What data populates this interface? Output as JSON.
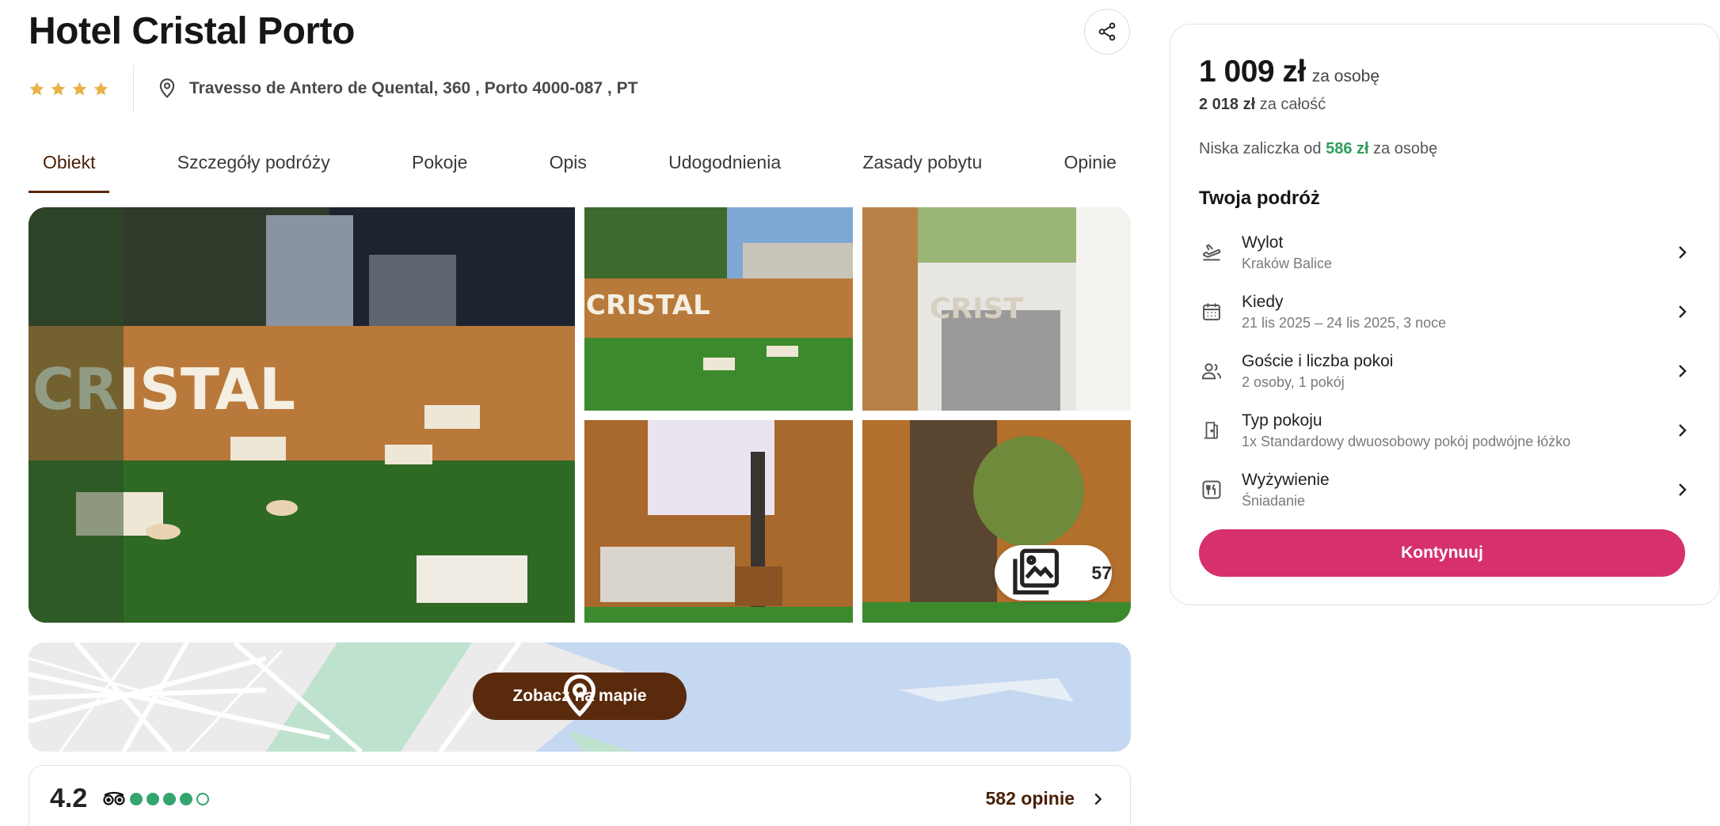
{
  "hotel": {
    "name": "Hotel Cristal Porto",
    "stars": 4,
    "address": "Travesso de Antero de Quental, 360 , Porto 4000-087 , PT"
  },
  "tabs": [
    {
      "label": "Obiekt",
      "active": true
    },
    {
      "label": "Szczegóły podróży"
    },
    {
      "label": "Pokoje"
    },
    {
      "label": "Opis"
    },
    {
      "label": "Udogodnienia"
    },
    {
      "label": "Zasady pobytu"
    },
    {
      "label": "Opinie"
    }
  ],
  "gallery": {
    "photo_count": "57",
    "icon": "photo-library-icon"
  },
  "map": {
    "button_label": "Zobacz na mapie",
    "icon": "location-pin-icon"
  },
  "reviews": {
    "rating": "4.2",
    "bubbles_filled": 4,
    "bubbles_total": 5,
    "count_label": "582 opinie"
  },
  "booking": {
    "price_per_person": "1 009 zł",
    "per_person_label": "za osobę",
    "price_total": "2 018 zł",
    "total_label": "za całość",
    "deposit_prefix": "Niska zaliczka od",
    "deposit_amount": "586 zł",
    "deposit_suffix": "za osobę",
    "trip_title": "Twoja podróż",
    "items": [
      {
        "label": "Wylot",
        "value": "Kraków Balice",
        "icon": "plane-departure-icon"
      },
      {
        "label": "Kiedy",
        "value": "21 lis 2025 – 24 lis 2025, 3 noce",
        "icon": "calendar-icon"
      },
      {
        "label": "Goście i liczba pokoi",
        "value": "2 osoby, 1 pokój",
        "icon": "people-icon"
      },
      {
        "label": "Typ pokoju",
        "value": "1x Standardowy dwuosobowy pokój podwójne łóżko",
        "icon": "door-icon"
      },
      {
        "label": "Wyżywienie",
        "value": "Śniadanie",
        "icon": "utensils-icon"
      }
    ],
    "continue_label": "Kontynuuj"
  },
  "colors": {
    "brand_brown": "#5a2a0c",
    "accent_pink": "#d6306d",
    "deposit_green": "#2e9e5a",
    "star_gold": "#e9b24a",
    "tripadvisor_green": "#34a56f"
  }
}
